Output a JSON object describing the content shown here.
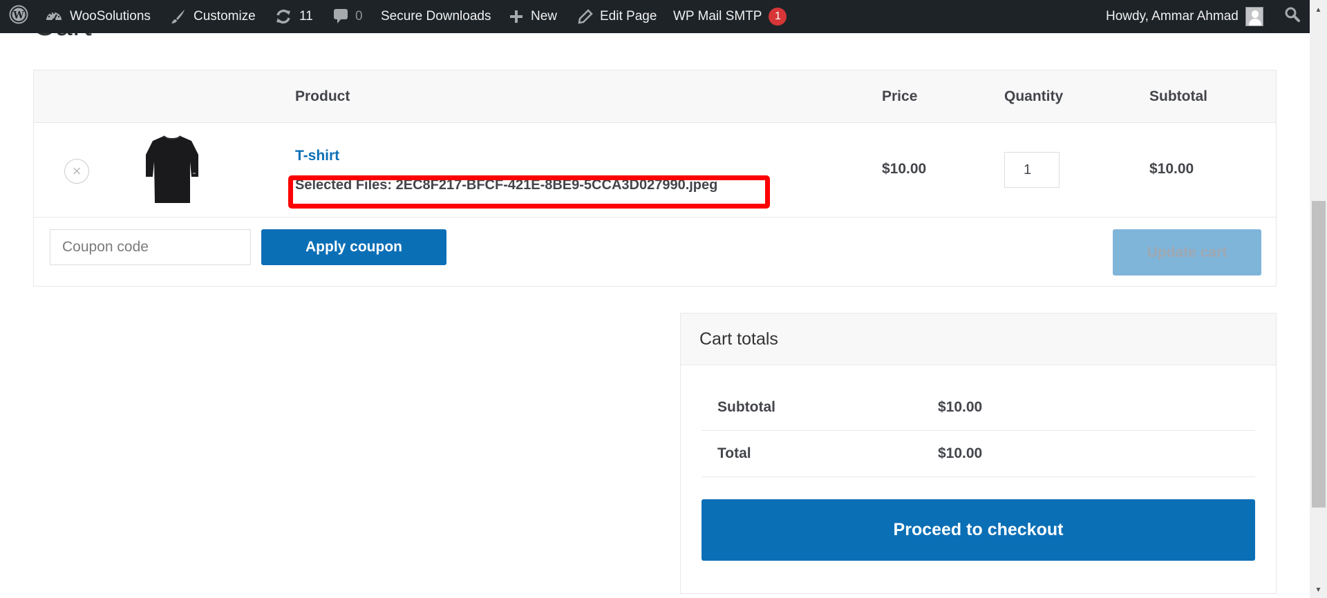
{
  "admin_bar": {
    "site_name": "WooSolutions",
    "customize": "Customize",
    "updates_count": "11",
    "comments_count": "0",
    "secure_downloads": "Secure Downloads",
    "new": "New",
    "edit_page": "Edit Page",
    "wp_mail_smtp": "WP Mail SMTP",
    "smtp_badge": "1",
    "howdy": "Howdy, Ammar Ahmad"
  },
  "page": {
    "title": "Cart"
  },
  "cart_table": {
    "headers": {
      "product": "Product",
      "price": "Price",
      "quantity": "Quantity",
      "subtotal": "Subtotal"
    },
    "items": [
      {
        "remove_symbol": "×",
        "name": "T-shirt",
        "selected_files": "Selected Files: 2EC8F217-BFCF-421E-8BE9-5CCA3D027990.jpeg",
        "price": "$10.00",
        "quantity": "1",
        "subtotal": "$10.00"
      }
    ],
    "coupon_placeholder": "Coupon code",
    "apply_coupon": "Apply coupon",
    "update_cart": "Update cart"
  },
  "cart_totals": {
    "title": "Cart totals",
    "rows": [
      {
        "label": "Subtotal",
        "value": "$10.00"
      },
      {
        "label": "Total",
        "value": "$10.00"
      }
    ],
    "checkout": "Proceed to checkout"
  },
  "colors": {
    "admin_bar": "#1d2327",
    "primary": "#0b6fb6",
    "update_disabled": "#80b5da",
    "highlight": "#ff0000",
    "badge": "#d63638"
  }
}
